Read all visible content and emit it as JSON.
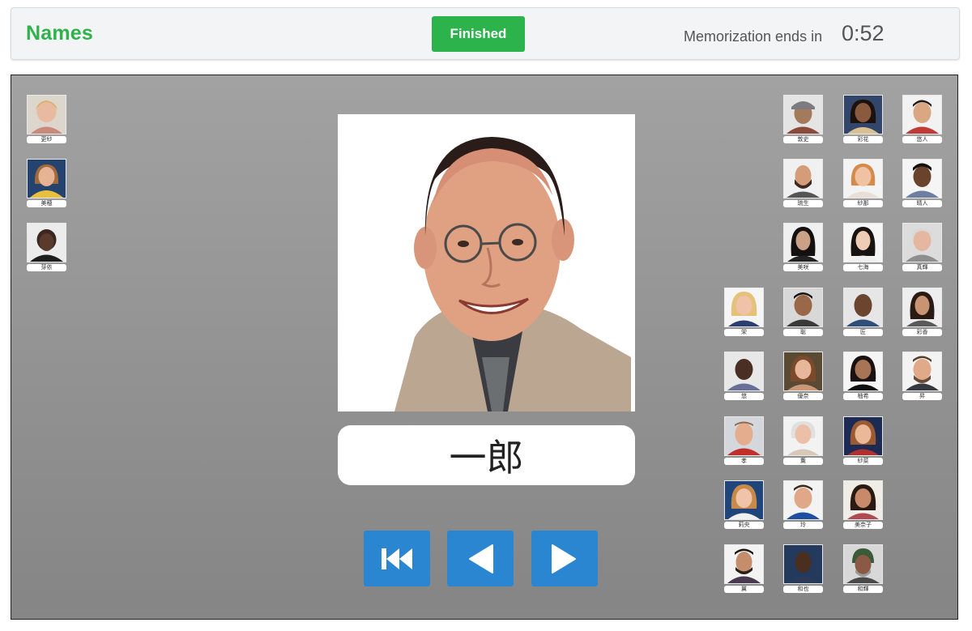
{
  "header": {
    "title": "Names",
    "finished_label": "Finished",
    "timer_label": "Memorization ends in",
    "timer_value": "0:52"
  },
  "current": {
    "name": "一郎"
  },
  "left_column": [
    {
      "name": "更紗"
    },
    {
      "name": "美穂"
    },
    {
      "name": "芽依"
    }
  ],
  "right_grid": [
    {
      "name": "敦史"
    },
    {
      "name": "彩花"
    },
    {
      "name": "悠人"
    },
    {
      "name": "琉生"
    },
    {
      "name": "紗那"
    },
    {
      "name": "晴人"
    },
    {
      "name": "美咲"
    },
    {
      "name": "七海"
    },
    {
      "name": "真輝"
    },
    {
      "name": "栄"
    },
    {
      "name": "聡"
    },
    {
      "name": "匠"
    },
    {
      "name": "彩香"
    },
    {
      "name": "悠"
    },
    {
      "name": "優奈"
    },
    {
      "name": "柚希"
    },
    {
      "name": "昇"
    },
    {
      "name": "孝"
    },
    {
      "name": "薫"
    },
    {
      "name": "紗菜"
    },
    {
      "name": "莉央"
    },
    {
      "name": "玲"
    },
    {
      "name": "美奈子"
    },
    {
      "name": "翼"
    },
    {
      "name": "和也"
    },
    {
      "name": "和輝"
    }
  ],
  "nav": {
    "first": "skip-to-first-icon",
    "prev": "previous-icon",
    "next": "next-icon"
  },
  "colors": {
    "accent_green": "#2cb34c",
    "nav_blue": "#2a86d1"
  }
}
